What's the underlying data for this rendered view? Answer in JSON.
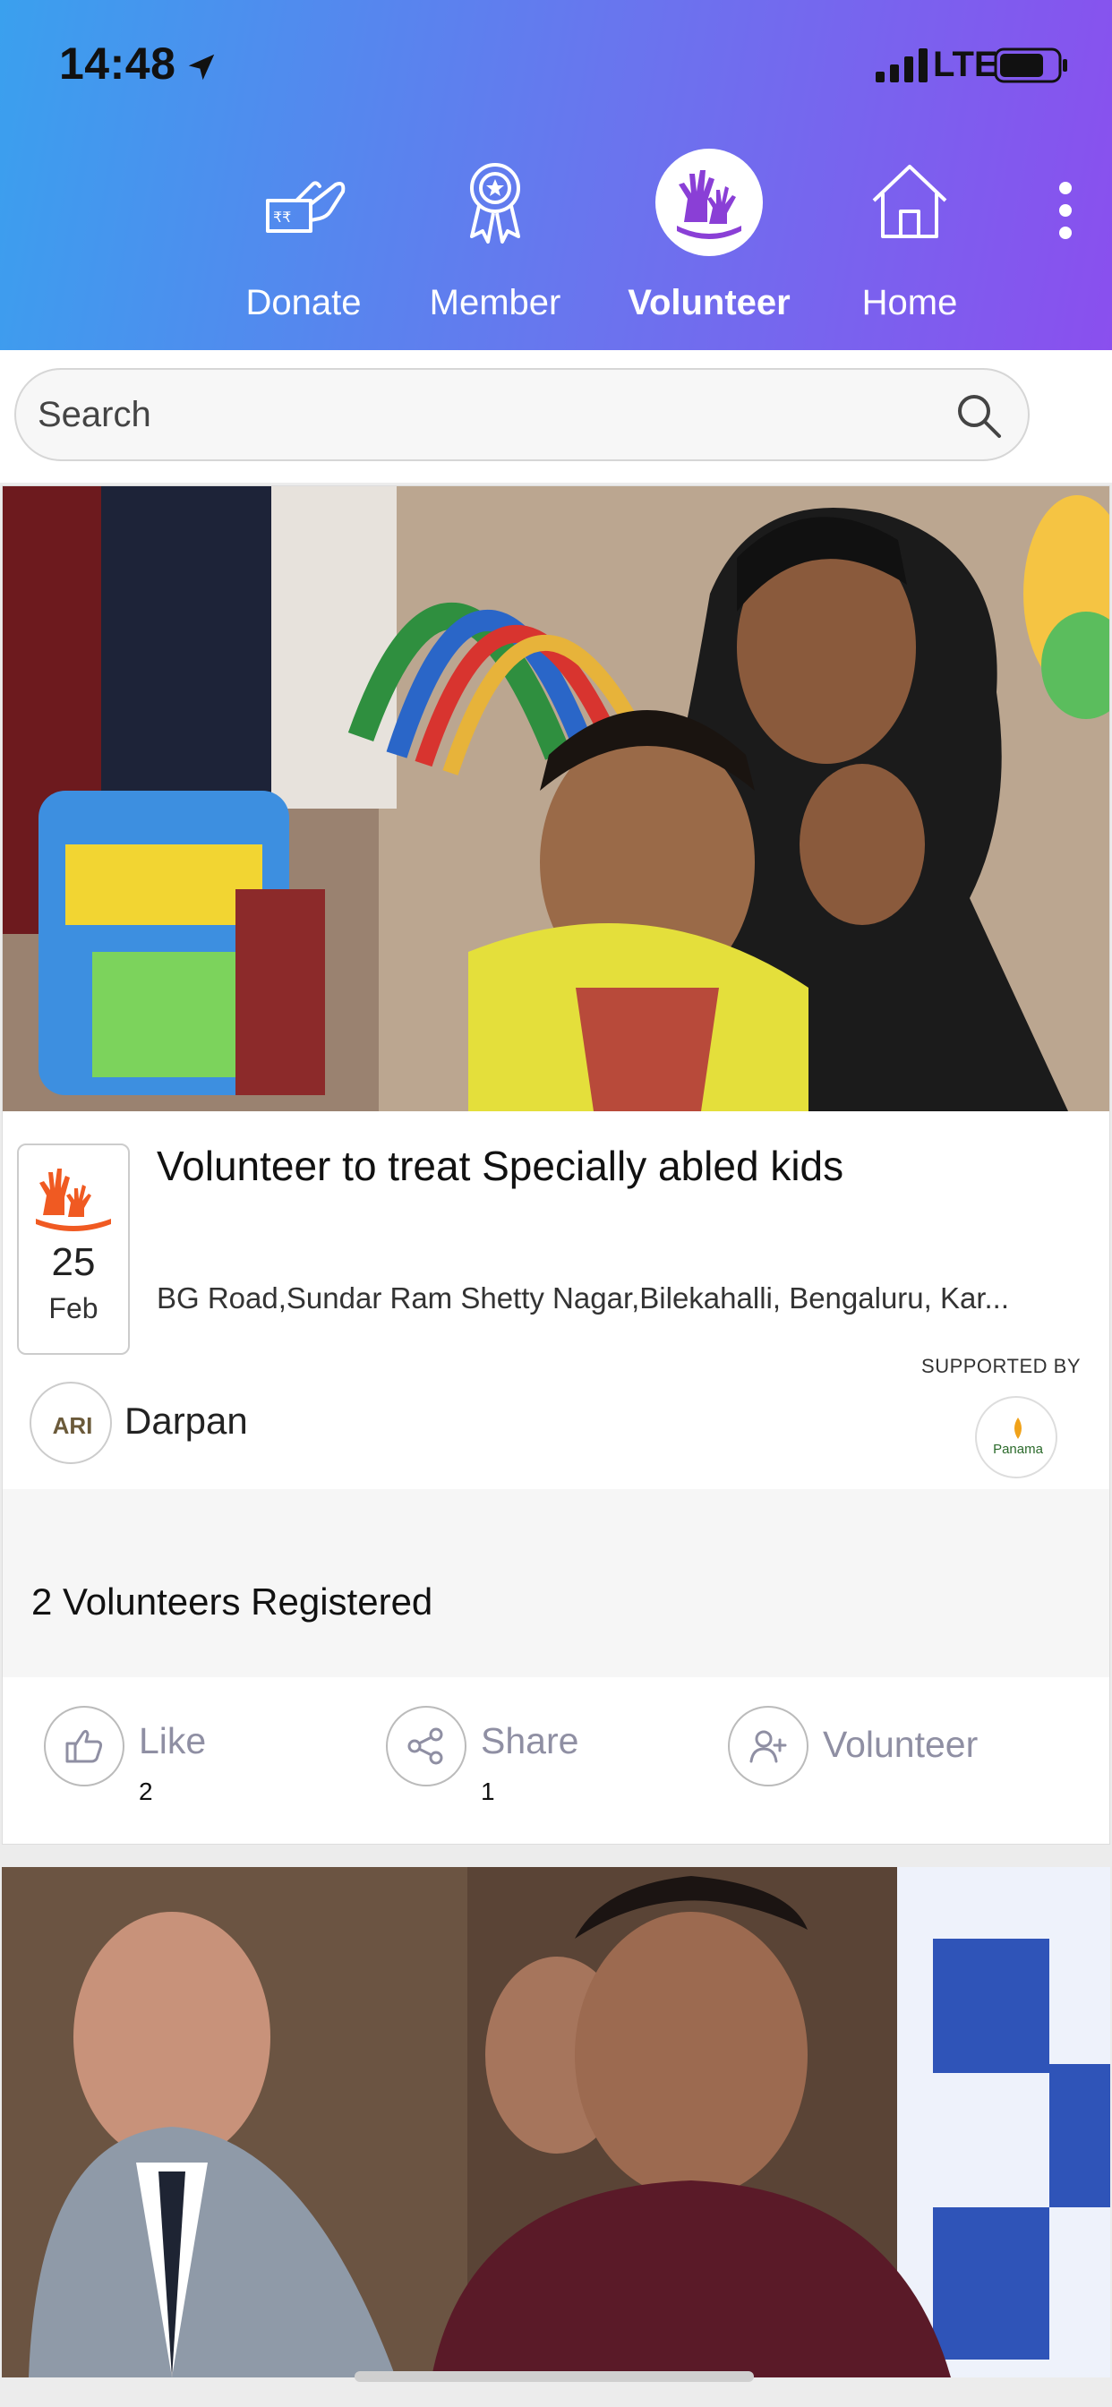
{
  "status_bar": {
    "time": "14:48",
    "network": "LTE"
  },
  "nav": {
    "items": [
      {
        "label": "Donate",
        "icon": "donate-hand-icon",
        "active": false
      },
      {
        "label": "Member",
        "icon": "award-badge-icon",
        "active": false
      },
      {
        "label": "Volunteer",
        "icon": "volunteer-hands-icon",
        "active": true
      },
      {
        "label": "Home",
        "icon": "home-icon",
        "active": false
      }
    ],
    "more_icon": "more-vertical-icon"
  },
  "search": {
    "placeholder": "Search",
    "icon": "search-icon"
  },
  "card": {
    "title": "Volunteer to treat Specially abled kids",
    "date_day": "25",
    "date_month": "Feb",
    "address": "BG Road,Sundar Ram Shetty Nagar,Bilekahalli, Bengaluru, Kar...",
    "org_logo_text": "ARI",
    "org_name": "Darpan",
    "supported_by_label": "SUPPORTED BY",
    "sponsor_logo_text": "Panama",
    "volunteers_count": "2",
    "volunteers_label": "Volunteers Registered",
    "actions": {
      "like_label": "Like",
      "like_count": "2",
      "share_label": "Share",
      "share_count": "1",
      "volunteer_label": "Volunteer"
    }
  },
  "colors": {
    "header_start": "#3aa0ee",
    "header_end": "#8a4fee",
    "accent_purple": "#8a3fd6",
    "volunteer_orange": "#f05a22",
    "action_gray": "#8f8fa3"
  }
}
